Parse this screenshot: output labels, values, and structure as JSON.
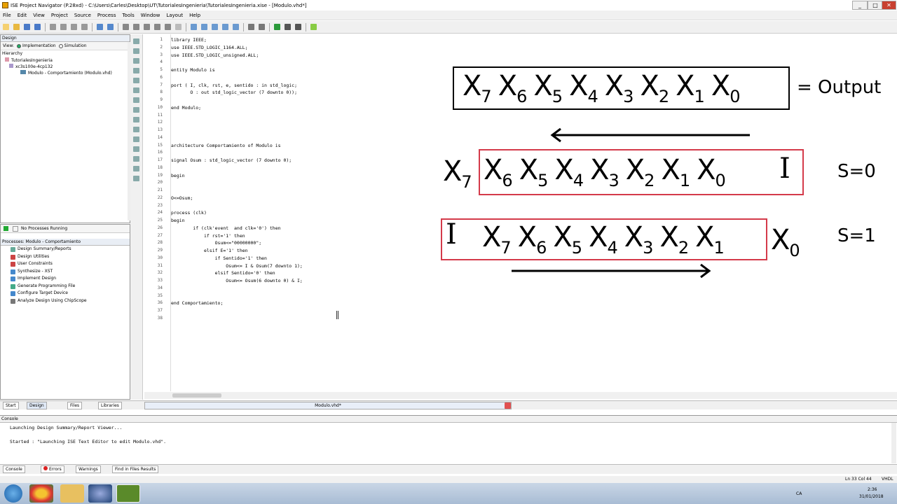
{
  "window": {
    "title": "ISE Project Navigator (P.28xd) - C:\\Users\\Carles\\Desktop\\UT\\TutorialesIngenieria\\TutorialesIngenieria.xise - [Modulo.vhd*]"
  },
  "menu": [
    "File",
    "Edit",
    "View",
    "Project",
    "Source",
    "Process",
    "Tools",
    "Window",
    "Layout",
    "Help"
  ],
  "design": {
    "panel_title": "Design",
    "view_label": "View:",
    "impl_label": "Implementation",
    "sim_label": "Simulation",
    "hierarchy_label": "Hierarchy",
    "tree": [
      "TutorialesIngenieria",
      "xc3s100e-4cp132",
      "Modulo - Comportamiento (Modulo.vhd)"
    ]
  },
  "processes": {
    "status": "No Processes Running",
    "header": "Processes: Modulo - Comportamiento",
    "items": [
      "Design Summary/Reports",
      "Design Utilities",
      "User Constraints",
      "Synthesize - XST",
      "Implement Design",
      "Generate Programming File",
      "Configure Target Device",
      "Analyze Design Using ChipScope"
    ]
  },
  "editor": {
    "line_numbers": [
      "1",
      "2",
      "3",
      "4",
      "5",
      "6",
      "7",
      "8",
      "9",
      "10",
      "11",
      "12",
      "13",
      "14",
      "15",
      "16",
      "17",
      "18",
      "19",
      "20",
      "21",
      "22",
      "23",
      "24",
      "25",
      "26",
      "27",
      "28",
      "29",
      "30",
      "31",
      "32",
      "33",
      "34",
      "35",
      "36",
      "37",
      "38"
    ],
    "lines": [
      "library IEEE;",
      "use IEEE.STD_LOGIC_1164.ALL;",
      "use IEEE.STD_LOGIC_unsigned.ALL;",
      "",
      "entity Modulo is",
      "",
      "port ( I, clk, rst, e, sentido : in std_logic;",
      "       O : out std_logic_vector (7 downto 0));",
      "",
      "end Modulo;",
      "",
      "",
      "",
      "",
      "architecture Comportamiento of Modulo is",
      "",
      "signal Osum : std_logic_vector (7 downto 0);",
      "",
      "begin",
      "",
      "",
      "O<=Osum;",
      "",
      "process (clk)",
      "begin",
      "        if (clk'event  and clk='0') then",
      "            if rst='1' then",
      "                Osum<=\"00000000\";",
      "            elsif E='1' then",
      "                if Sentido='1' then",
      "                    Osum<= I & Osum(7 downto 1);",
      "                elsif Sentido='0' then",
      "                    Osum<= Osum(6 downto 0) & I;",
      "",
      "",
      "end Comportamiento;",
      "",
      ""
    ]
  },
  "tabs": {
    "start": "Start",
    "design": "Design",
    "files": "Files",
    "libraries": "Libraries",
    "file_tab": "Modulo.vhd*"
  },
  "console": {
    "title": "Console",
    "lines": [
      "Launching Design Summary/Report Viewer...",
      "",
      "Started : \"Launching ISE Text Editor to edit Modulo.vhd\"."
    ],
    "tabs": [
      "Console",
      "Errors",
      "Warnings",
      "Find in Files Results"
    ]
  },
  "status": {
    "position": "Ln 33 Col 44",
    "lang": "VHDL"
  },
  "taskbar": {
    "time": "2:36",
    "date": "31/01/2018",
    "lang": "CA"
  },
  "overlay": {
    "row1": {
      "sequence": [
        "7",
        "6",
        "5",
        "4",
        "3",
        "2",
        "1",
        "0"
      ],
      "suffix": "= Output"
    },
    "row2": {
      "outside_left": "7",
      "inside": [
        "6",
        "5",
        "4",
        "3",
        "2",
        "1",
        "0"
      ],
      "input": "I",
      "label": "S=0"
    },
    "row3": {
      "input": "I",
      "inside": [
        "7",
        "6",
        "5",
        "4",
        "3",
        "2",
        "1"
      ],
      "outside_right": "0",
      "label": "S=1"
    },
    "colors": {
      "row1_border": "#000000",
      "box_border": "#d43a4a",
      "arrow": "#000000"
    }
  }
}
